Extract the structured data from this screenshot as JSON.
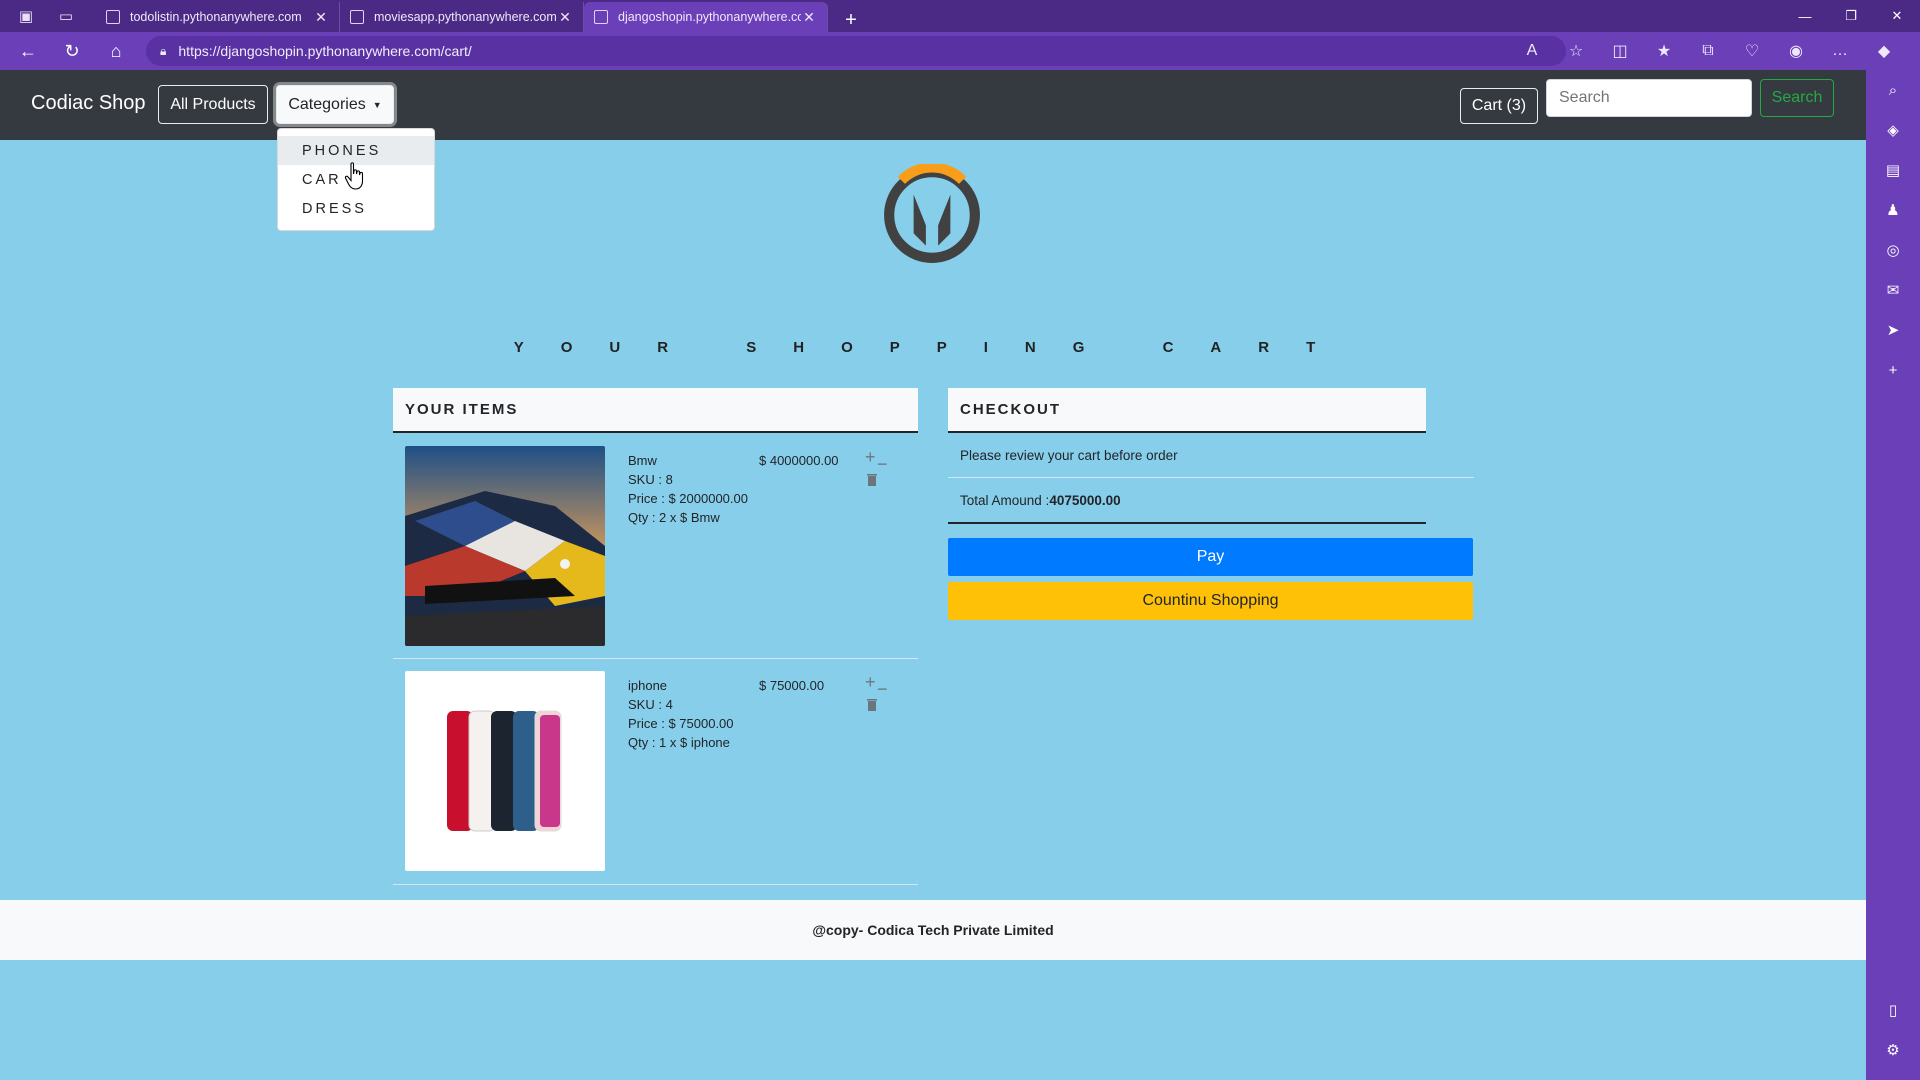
{
  "browser": {
    "tabs": [
      {
        "title": "todolistin.pythonanywhere.com",
        "active": false
      },
      {
        "title": "moviesapp.pythonanywhere.com",
        "active": false
      },
      {
        "title": "djangoshopin.pythonanywhere.com",
        "active": true
      }
    ],
    "url": "https://djangoshopin.pythonanywhere.com/cart/",
    "accent_color": "#6a3fb8"
  },
  "navbar": {
    "brand": "Codiac Shop",
    "all_products": "All Products",
    "categories": "Categories",
    "cart": "Cart (3)",
    "search_placeholder": "Search",
    "search_button": "Search"
  },
  "categories_menu": [
    "PHONES",
    "CAR",
    "DRESS"
  ],
  "heading": "YOUR SHOPPING CART",
  "items_panel": {
    "title": "YOUR ITEMS",
    "items": [
      {
        "name": "Bmw",
        "sku": "SKU : 8",
        "price": "Price : $ 2000000.00",
        "qty": "Qty : 2 x $ Bmw",
        "total": "$ 4000000.00",
        "image": "car"
      },
      {
        "name": "iphone",
        "sku": "SKU : 4",
        "price": "Price : $ 75000.00",
        "qty": "Qty : 1 x $ iphone",
        "total": "$ 75000.00",
        "image": "phones"
      }
    ]
  },
  "checkout": {
    "title": "CHECKOUT",
    "note": "Please review your cart before order",
    "total_label": "Total Amound : ",
    "total_value": "4075000.00",
    "pay": "Pay",
    "continue": "Countinu Shopping"
  },
  "footer": "@copy- Codica Tech Private Limited"
}
